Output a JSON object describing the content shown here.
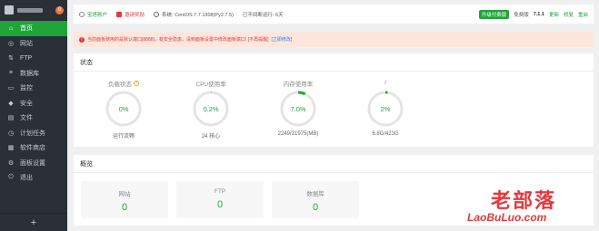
{
  "sidebar": {
    "badge": "0",
    "items": [
      {
        "label": "首页",
        "icon": "home-icon",
        "glyph": "⌂",
        "active": true
      },
      {
        "label": "网站",
        "icon": "globe-icon",
        "glyph": "◎"
      },
      {
        "label": "FTP",
        "icon": "ftp-icon",
        "glyph": "⇅"
      },
      {
        "label": "数据库",
        "icon": "database-icon",
        "glyph": "≡"
      },
      {
        "label": "监控",
        "icon": "monitor-icon",
        "glyph": "▭"
      },
      {
        "label": "安全",
        "icon": "shield-icon",
        "glyph": "◆"
      },
      {
        "label": "文件",
        "icon": "folder-icon",
        "glyph": "▤"
      },
      {
        "label": "计划任务",
        "icon": "clock-icon",
        "glyph": "◷"
      },
      {
        "label": "软件商店",
        "icon": "store-icon",
        "glyph": "▦"
      },
      {
        "label": "面板设置",
        "icon": "gear-icon",
        "glyph": "⚙"
      },
      {
        "label": "退出",
        "icon": "logout-icon",
        "glyph": "⏻"
      }
    ],
    "add_label": "+"
  },
  "topbar": {
    "account": "宝塔账户",
    "reward": "邀请奖励",
    "system": "系统: CentOS 7.7.1908(Py2.7.5)",
    "uptime": "已不间断运行: 6天",
    "pro_button": "升级付费版",
    "edition": "免费版",
    "version": "7.1.1",
    "update": "更新",
    "repair": "修复",
    "restart": "重启"
  },
  "alert": {
    "text": "当前面板使用的是默认端口[8888]，有安全隐患，请到面板设置中修改面板端口! [不再提醒]",
    "link": "[立即修改]"
  },
  "status": {
    "title": "状态",
    "gauges": [
      {
        "name": "load",
        "title": "负载状态",
        "help": "?",
        "value": "0%",
        "percent": 0,
        "sub": "运行流畅"
      },
      {
        "name": "cpu",
        "title": "CPU使用率",
        "value": "0.2%",
        "percent": 0.2,
        "sub": "24 核心"
      },
      {
        "name": "memory",
        "title": "内存使用率",
        "value": "7.0%",
        "percent": 7.0,
        "sub": "2249/31975(MB)"
      },
      {
        "name": "disk",
        "title": "/",
        "value": "2%",
        "percent": 2,
        "sub": "6.8G/423G"
      }
    ]
  },
  "overview": {
    "title": "概览",
    "cards": [
      {
        "label": "网站",
        "value": "0"
      },
      {
        "label": "FTP",
        "value": "0"
      },
      {
        "label": "数据库",
        "value": "0"
      }
    ]
  },
  "watermark": {
    "cn": "老部落",
    "en": "LaoBuLuo.com"
  },
  "colors": {
    "accent": "#20a53a",
    "sidebar_bg": "#2b2f36",
    "alert_bg": "#fde7dd",
    "alert_text": "#e4393c"
  }
}
